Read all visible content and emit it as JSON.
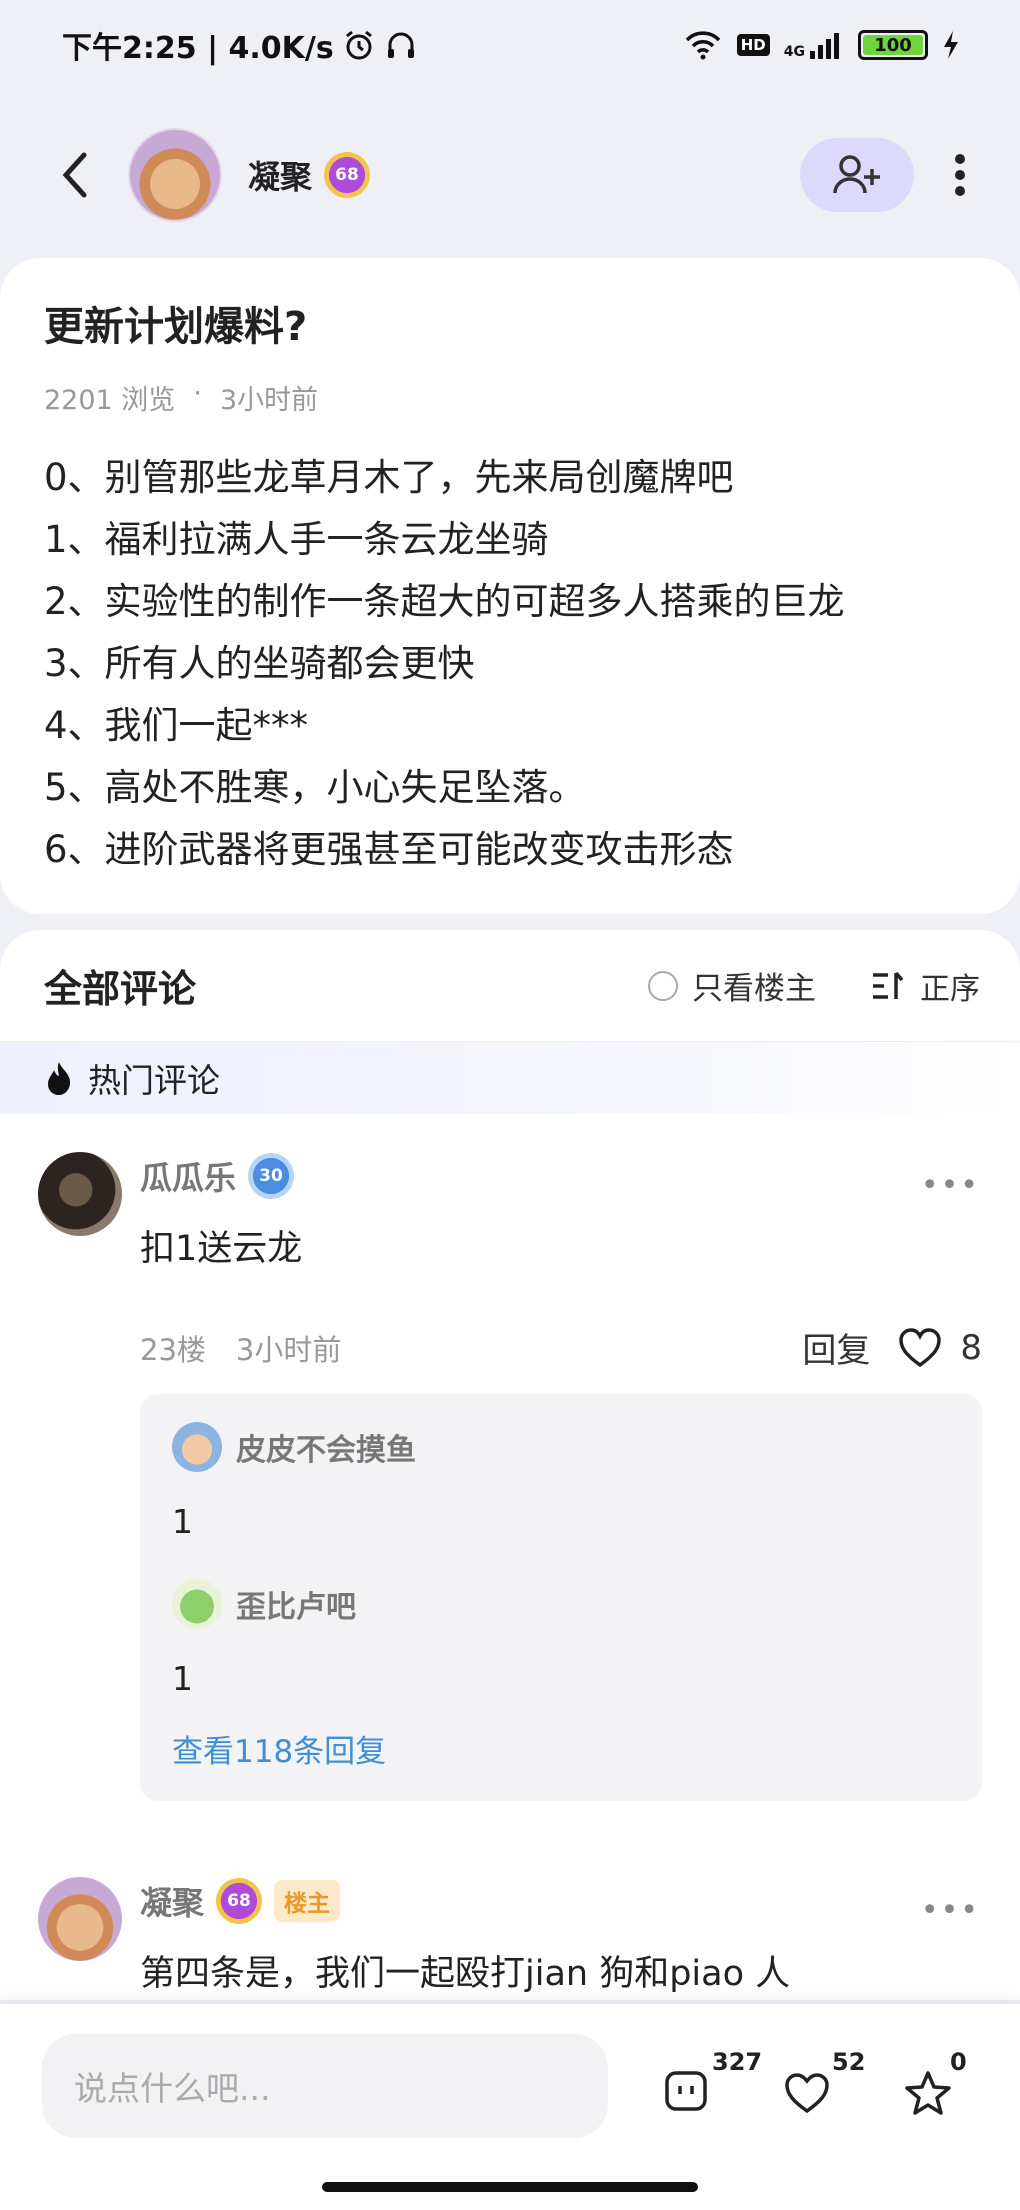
{
  "status_bar": {
    "time_net": "下午2:25 | 4.0K/s",
    "hd": "HD",
    "signal": "4G",
    "battery": "100"
  },
  "header": {
    "author": "凝聚",
    "level": "68"
  },
  "post": {
    "title": "更新计划爆料?",
    "views": "2201 浏览",
    "dot": "·",
    "time": "3小时前",
    "lines": [
      "0、别管那些龙草月木了，先来局创魔牌吧",
      "1、福利拉满人手一条云龙坐骑",
      "2、实验性的制作一条超大的可超多人搭乘的巨龙",
      "3、所有人的坐骑都会更快",
      "4、我们一起***",
      "5、高处不胜寒，小心失足坠落。",
      "6、进阶武器将更强甚至可能改变攻击形态"
    ]
  },
  "comments": {
    "title": "全部评论",
    "only_op": "只看楼主",
    "sort": "正序",
    "hot": "热门评论",
    "items": [
      {
        "name": "瓜瓜乐",
        "level": "30",
        "text": "扣1送云龙",
        "floor": "23楼",
        "time": "3小时前",
        "reply_label": "回复",
        "likes": "8",
        "replies": [
          {
            "name": "皮皮不会摸鱼",
            "text": "1"
          },
          {
            "name": "歪比卢吧",
            "text": "1"
          }
        ],
        "view_more": "查看118条回复"
      },
      {
        "name": "凝聚",
        "level": "68",
        "tag": "楼主",
        "text": "第四条是，我们一起殴打jian 狗和piao 人"
      }
    ]
  },
  "bottom": {
    "placeholder": "说点什么吧...",
    "comment_count": "327",
    "like_count": "52",
    "fav_count": "0"
  },
  "colors": {
    "accent": "#dcd9fb",
    "link": "#3f8fd6",
    "op_tag": "#e59a29"
  }
}
